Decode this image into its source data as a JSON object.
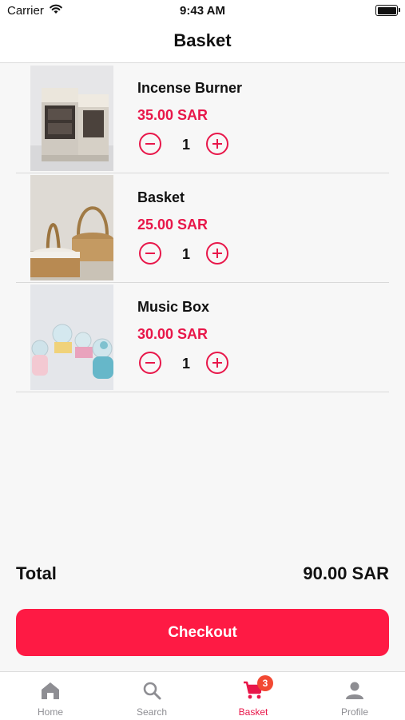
{
  "status_bar": {
    "carrier": "Carrier",
    "time": "9:43 AM"
  },
  "header": {
    "title": "Basket"
  },
  "items": [
    {
      "name": "Incense Burner",
      "price": "35.00 SAR",
      "quantity": "1",
      "image": "incense-burner-photo"
    },
    {
      "name": "Basket",
      "price": "25.00 SAR",
      "quantity": "1",
      "image": "wicker-basket-photo"
    },
    {
      "name": "Music Box",
      "price": "30.00 SAR",
      "quantity": "1",
      "image": "snow-globe-music-box-photo"
    }
  ],
  "summary": {
    "total_label": "Total",
    "total_value": "90.00 SAR"
  },
  "checkout": {
    "label": "Checkout"
  },
  "tabs": [
    {
      "label": "Home",
      "icon": "home-icon",
      "active": false
    },
    {
      "label": "Search",
      "icon": "search-icon",
      "active": false
    },
    {
      "label": "Basket",
      "icon": "cart-icon",
      "active": true,
      "badge": "3"
    },
    {
      "label": "Profile",
      "icon": "person-icon",
      "active": false
    }
  ],
  "colors": {
    "accent": "#e8174a",
    "button": "#fe1a44",
    "badge": "#f24933",
    "inactive_tab": "#8e8e93"
  }
}
